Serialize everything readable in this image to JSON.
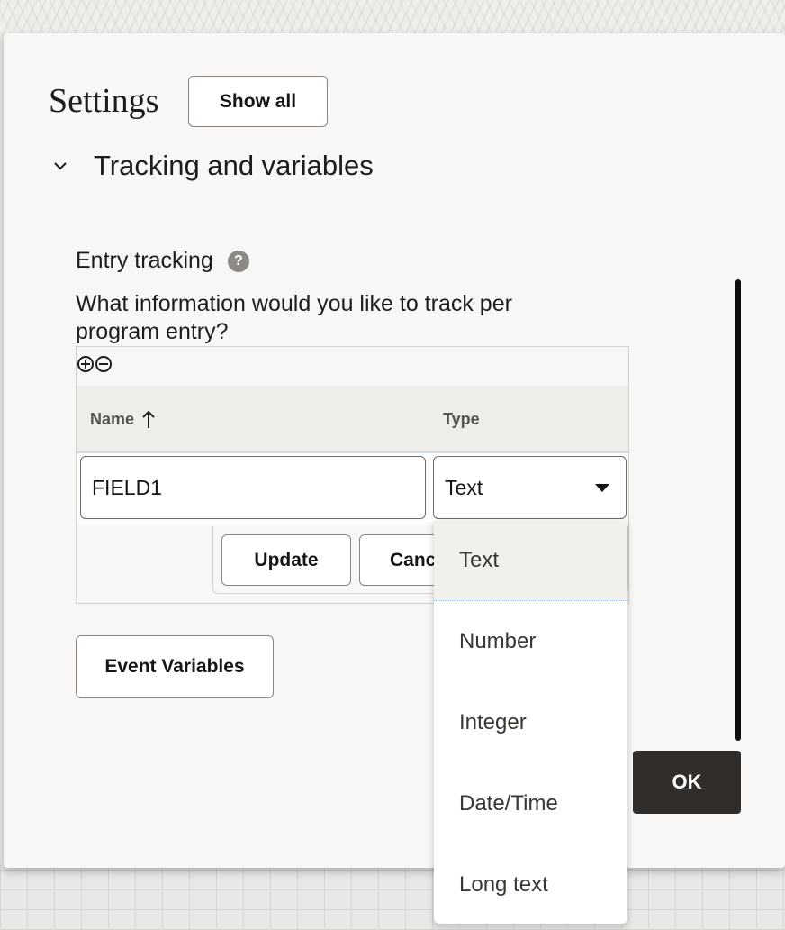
{
  "settings": {
    "title": "Settings",
    "show_all_label": "Show all"
  },
  "section": {
    "title": "Tracking and variables"
  },
  "entry_tracking": {
    "label": "Entry tracking",
    "help_glyph": "?",
    "question": "What information would you like to track per program entry?"
  },
  "grid": {
    "columns": {
      "name": "Name",
      "type": "Type"
    },
    "row": {
      "name_value": "FIELD1",
      "type_value": "Text"
    },
    "update_label": "Update",
    "cancel_label": "Cancel"
  },
  "event_variables_label": "Event Variables",
  "ok_label": "OK",
  "type_options": [
    "Text",
    "Number",
    "Integer",
    "Date/Time",
    "Long text"
  ],
  "icons": {
    "expand": "chevron-down-icon",
    "help": "help-icon",
    "add_row": "plus-circle-icon",
    "remove_row": "minus-circle-icon",
    "sort": "arrow-up-icon",
    "dropdown": "caret-down-icon"
  },
  "colors": {
    "primary_button": "#312d2a",
    "dialog_background": "#f8f7f5",
    "header_row": "#eeedea"
  }
}
